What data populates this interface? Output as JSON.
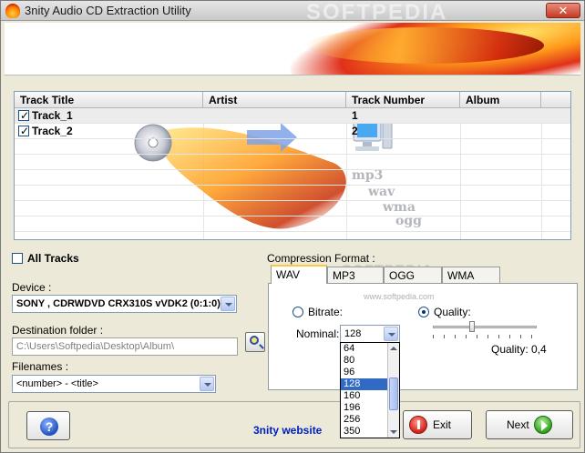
{
  "window": {
    "title": "3nity Audio CD Extraction Utility",
    "close_glyph": "✕",
    "watermark": "SOFTPEDIA"
  },
  "track_list": {
    "columns": [
      "Track Title",
      "Artist",
      "Track Number",
      "Album"
    ],
    "rows": [
      {
        "title": "Track_1",
        "artist": "",
        "number": "1",
        "album": "",
        "checked": true
      },
      {
        "title": "Track_2",
        "artist": "",
        "number": "2",
        "album": "",
        "checked": true
      }
    ],
    "graphic_words": [
      "mp3",
      "wav",
      "wma",
      "ogg"
    ]
  },
  "all_tracks": {
    "label": "All Tracks",
    "checked": false
  },
  "device": {
    "label": "Device  :",
    "value": "SONY     , CDRWDVD CRX310S  vVDK2 (0:1:0)"
  },
  "destination": {
    "label": "Destination folder :",
    "value": "C:\\Users\\Softpedia\\Desktop\\Album\\"
  },
  "filenames": {
    "label": "Filenames :",
    "value": "<number> - <title>"
  },
  "compression": {
    "label": "Compression Format :",
    "tabs": [
      "WAV",
      "MP3",
      "OGG",
      "WMA"
    ],
    "active_tab": "WAV",
    "bitrate_label": "Bitrate:",
    "quality_label": "Quality:",
    "bitrate_selected": false,
    "quality_selected": true,
    "nominal_label": "Nominal:",
    "nominal_value": "128",
    "nominal_options": [
      "64",
      "80",
      "96",
      "128",
      "160",
      "196",
      "256",
      "350"
    ],
    "nominal_highlighted": "128",
    "quality_value_label": "Quality: 0,4",
    "watermark": "SOFTPEDIA",
    "watermark_url": "www.softpedia.com"
  },
  "bottom": {
    "help_glyph": "?",
    "website_link": "3nity website",
    "exit_label": "Exit",
    "next_label": "Next"
  },
  "colors": {
    "accent_blue": "#316ac5",
    "link": "#0020c0",
    "exit_red": "#d4201a",
    "next_green": "#2ea01e"
  }
}
